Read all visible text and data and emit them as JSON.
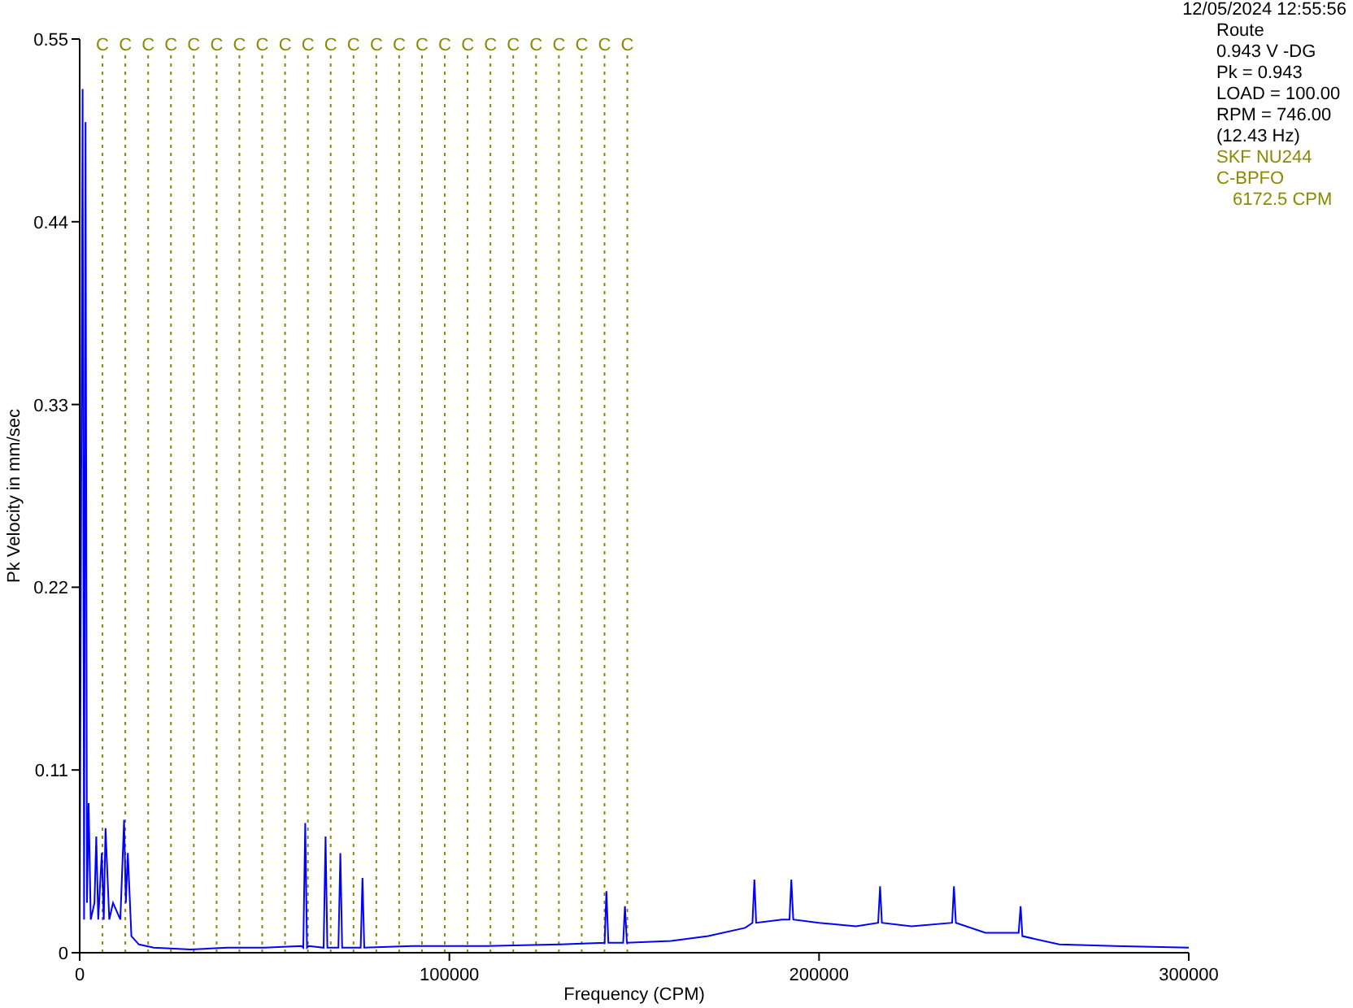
{
  "timestamp": "12/05/2024 12:55:56",
  "info_panel": {
    "lines": [
      {
        "text": "Route",
        "kind": "info"
      },
      {
        "text": "0.943 V -DG",
        "kind": "info"
      },
      {
        "text": "Pk = 0.943",
        "kind": "info"
      },
      {
        "text": "LOAD = 100.00",
        "kind": "info"
      },
      {
        "text": "RPM = 746.00",
        "kind": "info"
      },
      {
        "text": "(12.43 Hz)",
        "kind": "info"
      },
      {
        "text": "SKF NU244",
        "kind": "fault"
      },
      {
        "text": "C-BPFO",
        "kind": "fault"
      },
      {
        "text": "6172.5 CPM",
        "kind": "fault-value"
      }
    ]
  },
  "chart_data": {
    "type": "line",
    "xlabel": "Frequency (CPM)",
    "ylabel": "Pk Velocity in mm/sec",
    "x": [
      0,
      800,
      1200,
      1600,
      2000,
      2400,
      3000,
      4000,
      4500,
      5000,
      6000,
      6500,
      7000,
      8000,
      9000,
      11000,
      12000,
      12500,
      13000,
      14000,
      16000,
      20000,
      30000,
      40000,
      50000,
      60000,
      60500,
      61000,
      61500,
      62000,
      66000,
      66500,
      67000,
      70000,
      70500,
      71000,
      76000,
      76500,
      77000,
      90000,
      110000,
      130000,
      142000,
      142500,
      143000,
      147000,
      147500,
      148000,
      160000,
      170000,
      180000,
      182000,
      182500,
      183000,
      190000,
      192000,
      192500,
      193000,
      200000,
      210000,
      216000,
      216500,
      217000,
      225000,
      236000,
      236500,
      237000,
      245000,
      254000,
      254500,
      255000,
      265000,
      280000,
      300000
    ],
    "series": [
      {
        "color": "#0000ff",
        "values": [
          0.02,
          0.52,
          0.02,
          0.5,
          0.03,
          0.09,
          0.02,
          0.03,
          0.07,
          0.02,
          0.06,
          0.02,
          0.075,
          0.02,
          0.03,
          0.02,
          0.08,
          0.03,
          0.06,
          0.01,
          0.005,
          0.003,
          0.002,
          0.003,
          0.003,
          0.004,
          0.003,
          0.078,
          0.003,
          0.004,
          0.003,
          0.07,
          0.003,
          0.003,
          0.06,
          0.003,
          0.003,
          0.045,
          0.003,
          0.004,
          0.004,
          0.005,
          0.006,
          0.037,
          0.006,
          0.006,
          0.028,
          0.006,
          0.007,
          0.01,
          0.015,
          0.018,
          0.044,
          0.018,
          0.02,
          0.02,
          0.044,
          0.02,
          0.018,
          0.016,
          0.018,
          0.04,
          0.018,
          0.016,
          0.018,
          0.04,
          0.018,
          0.012,
          0.012,
          0.028,
          0.01,
          0.005,
          0.004,
          0.003
        ]
      }
    ],
    "xlim": [
      0,
      300000
    ],
    "ylim": [
      0,
      0.55
    ],
    "xticks": [
      0,
      100000,
      200000,
      300000
    ],
    "yticks": [
      0,
      0.11,
      0.22,
      0.33,
      0.44,
      0.55
    ],
    "ref_lines": [
      {
        "axis": "x",
        "value": 6172.5,
        "label": "C"
      },
      {
        "axis": "x",
        "value": 12345,
        "label": "C"
      },
      {
        "axis": "x",
        "value": 18517.5,
        "label": "C"
      },
      {
        "axis": "x",
        "value": 24690,
        "label": "C"
      },
      {
        "axis": "x",
        "value": 30862.5,
        "label": "C"
      },
      {
        "axis": "x",
        "value": 37035,
        "label": "C"
      },
      {
        "axis": "x",
        "value": 43207.5,
        "label": "C"
      },
      {
        "axis": "x",
        "value": 49380,
        "label": "C"
      },
      {
        "axis": "x",
        "value": 55552.5,
        "label": "C"
      },
      {
        "axis": "x",
        "value": 61725,
        "label": "C"
      },
      {
        "axis": "x",
        "value": 67897.5,
        "label": "C"
      },
      {
        "axis": "x",
        "value": 74070,
        "label": "C"
      },
      {
        "axis": "x",
        "value": 80242.5,
        "label": "C"
      },
      {
        "axis": "x",
        "value": 86415,
        "label": "C"
      },
      {
        "axis": "x",
        "value": 92587.5,
        "label": "C"
      },
      {
        "axis": "x",
        "value": 98760,
        "label": "C"
      },
      {
        "axis": "x",
        "value": 104932.5,
        "label": "C"
      },
      {
        "axis": "x",
        "value": 111105,
        "label": "C"
      },
      {
        "axis": "x",
        "value": 117277.5,
        "label": "C"
      },
      {
        "axis": "x",
        "value": 123450,
        "label": "C"
      },
      {
        "axis": "x",
        "value": 129622.5,
        "label": "C"
      },
      {
        "axis": "x",
        "value": 135795,
        "label": "C"
      },
      {
        "axis": "x",
        "value": 141967.5,
        "label": "C"
      },
      {
        "axis": "x",
        "value": 148140,
        "label": "C"
      }
    ]
  }
}
